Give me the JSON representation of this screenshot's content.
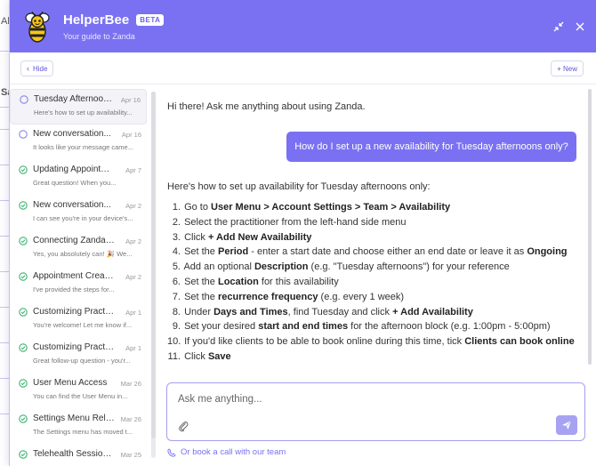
{
  "background": {
    "fragments": [
      "Al",
      "Sa"
    ]
  },
  "header": {
    "app_name": "HelperBee",
    "badge": "BETA",
    "subtitle": "Your guide to Zanda",
    "accent_color": "#7a71f2",
    "icons": [
      "bee-logo",
      "minimize-icon",
      "close-icon"
    ]
  },
  "toolbar": {
    "hide_label": "Hide",
    "new_label": "+ New"
  },
  "sidebar": {
    "items": [
      {
        "title": "Tuesday Afternoon ...",
        "date": "Apr 16",
        "preview": "Here's how to set up availability...",
        "status": "open",
        "active": true
      },
      {
        "title": "New conversation...",
        "date": "Apr 16",
        "preview": "It looks like your message came...",
        "status": "open",
        "active": false
      },
      {
        "title": "Updating Appointm...",
        "date": "Apr 7",
        "preview": "Great question! When you...",
        "status": "done",
        "active": false
      },
      {
        "title": "New conversation...",
        "date": "Apr 2",
        "preview": "I can see you're in your device's...",
        "status": "done",
        "active": false
      },
      {
        "title": "Connecting Zanda T...",
        "date": "Apr 2",
        "preview": "Yes, you absolutely can! 🎉 We...",
        "status": "done",
        "active": false
      },
      {
        "title": "Appointment Creati...",
        "date": "Apr 2",
        "preview": "I've provided the steps for...",
        "status": "done",
        "active": false
      },
      {
        "title": "Customizing Practiti...",
        "date": "Apr 1",
        "preview": "You're welcome! Let me know if...",
        "status": "done",
        "active": false
      },
      {
        "title": "Customizing Practiti...",
        "date": "Apr 1",
        "preview": "Great follow-up question - you'r...",
        "status": "done",
        "active": false
      },
      {
        "title": "User Menu Access",
        "date": "Mar 26",
        "preview": "You can find the User Menu in...",
        "status": "done",
        "active": false
      },
      {
        "title": "Settings Menu Relo...",
        "date": "Mar 26",
        "preview": "The Settings menu has moved t...",
        "status": "done",
        "active": false
      },
      {
        "title": "Telehealth Session ...",
        "date": "Mar 25",
        "preview": "",
        "status": "done",
        "active": false
      }
    ]
  },
  "chat": {
    "greeting": "Hi there! Ask me anything about using Zanda.",
    "user_message": "How do I set up a new availability for Tuesday afternoons only?",
    "answer_intro": "Here's how to set up availability for Tuesday afternoons only:",
    "steps": [
      [
        {
          "t": "Go to "
        },
        {
          "b": "User Menu > Account Settings > Team > Availability"
        }
      ],
      [
        {
          "t": "Select the practitioner from the left-hand side menu"
        }
      ],
      [
        {
          "t": "Click "
        },
        {
          "b": "+ Add New Availability"
        }
      ],
      [
        {
          "t": "Set the "
        },
        {
          "b": "Period"
        },
        {
          "t": " - enter a start date and choose either an end date or leave it as "
        },
        {
          "b": "Ongoing"
        }
      ],
      [
        {
          "t": "Add an optional "
        },
        {
          "b": "Description"
        },
        {
          "t": " (e.g. \"Tuesday afternoons\") for your reference"
        }
      ],
      [
        {
          "t": "Set the "
        },
        {
          "b": "Location"
        },
        {
          "t": " for this availability"
        }
      ],
      [
        {
          "t": "Set the "
        },
        {
          "b": "recurrence frequency"
        },
        {
          "t": " (e.g. every 1 week)"
        }
      ],
      [
        {
          "t": "Under "
        },
        {
          "b": "Days and Times"
        },
        {
          "t": ", find Tuesday and click "
        },
        {
          "b": "+ Add Availability"
        }
      ],
      [
        {
          "t": "Set your desired "
        },
        {
          "b": "start and end times"
        },
        {
          "t": " for the afternoon block (e.g. 1:00pm - 5:00pm)"
        }
      ],
      [
        {
          "t": "If you'd like clients to be able to book online during this time, tick "
        },
        {
          "b": "Clients can book online"
        }
      ],
      [
        {
          "t": "Click "
        },
        {
          "b": "Save"
        }
      ]
    ]
  },
  "composer": {
    "placeholder": "Ask me anything...",
    "book_call": "Or book a call with our team"
  }
}
